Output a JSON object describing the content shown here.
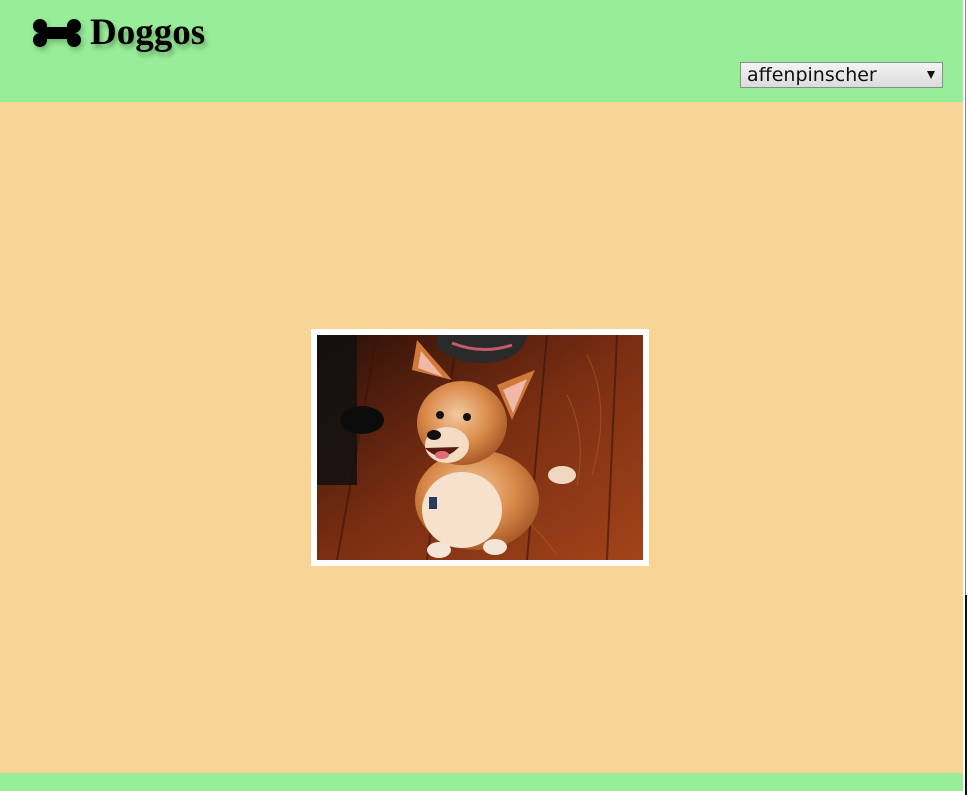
{
  "header": {
    "logo_icon": "bone-icon",
    "title": "Doggos",
    "background_color": "#98ee98"
  },
  "breed_select": {
    "selected": "affenpinscher",
    "icon": "chevron-down-icon"
  },
  "main": {
    "background_color": "#f8d495",
    "dog_image": {
      "frame_color": "#ffffff"
    }
  },
  "footer": {
    "background_color": "#98ee98"
  }
}
